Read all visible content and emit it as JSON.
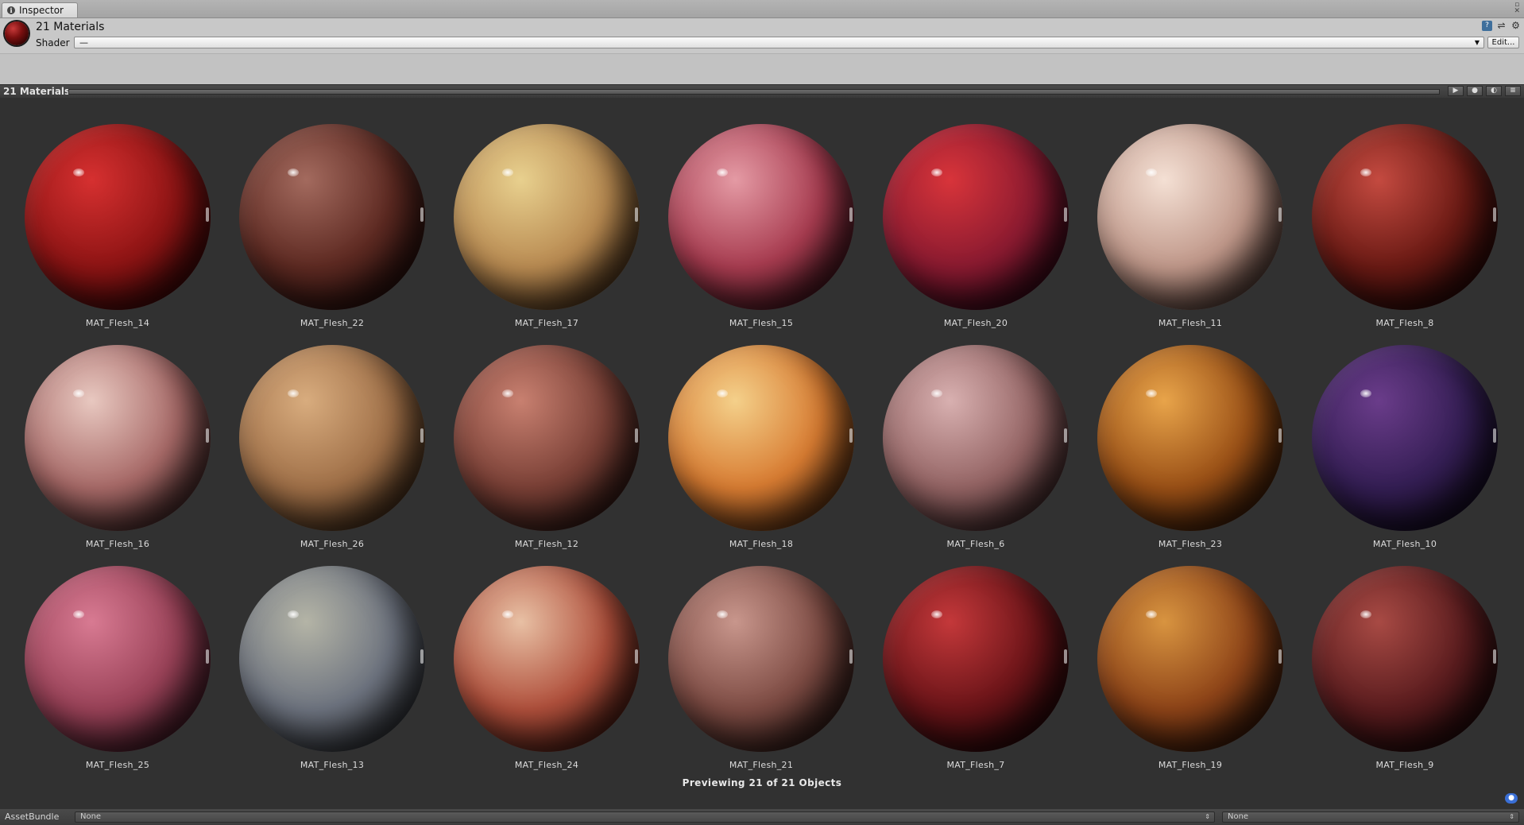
{
  "tab": {
    "label": "Inspector",
    "icon": "info-icon"
  },
  "header": {
    "title": "21 Materials",
    "shader_label": "Shader",
    "shader_value": "—",
    "edit_label": "Edit...",
    "icons": [
      "help-book-icon",
      "preset-icon",
      "gear-icon"
    ]
  },
  "preview": {
    "title": "21 Materials",
    "controls": [
      "play-icon",
      "sphere-preview-icon",
      "light-toggle-icon",
      "menu-icon"
    ],
    "status": "Previewing 21 of 21 Objects"
  },
  "materials": [
    {
      "name": "MAT_Flesh_14",
      "colors": [
        "#d63030",
        "#8e1414",
        "#3a0505"
      ]
    },
    {
      "name": "MAT_Flesh_22",
      "colors": [
        "#a36a5e",
        "#5e2a22",
        "#230a08"
      ]
    },
    {
      "name": "MAT_Flesh_17",
      "colors": [
        "#e8d08e",
        "#b98b52",
        "#4a2a12"
      ]
    },
    {
      "name": "MAT_Flesh_15",
      "colors": [
        "#e49aa4",
        "#a83c50",
        "#3a0c14"
      ]
    },
    {
      "name": "MAT_Flesh_20",
      "colors": [
        "#d8343a",
        "#8a1a30",
        "#2a0518"
      ]
    },
    {
      "name": "MAT_Flesh_11",
      "colors": [
        "#f4e0d4",
        "#c0988a",
        "#4a3028"
      ]
    },
    {
      "name": "MAT_Flesh_8",
      "colors": [
        "#c44a40",
        "#6a1a14",
        "#1e0404"
      ]
    },
    {
      "name": "MAT_Flesh_16",
      "colors": [
        "#e8c8c0",
        "#a86a68",
        "#3a1e1e"
      ]
    },
    {
      "name": "MAT_Flesh_26",
      "colors": [
        "#d8ac7e",
        "#a07048",
        "#3e2612"
      ]
    },
    {
      "name": "MAT_Flesh_12",
      "colors": [
        "#c88070",
        "#7a4036",
        "#2a1410"
      ]
    },
    {
      "name": "MAT_Flesh_18",
      "colors": [
        "#f4d08a",
        "#d87c32",
        "#5a2a0c"
      ]
    },
    {
      "name": "MAT_Flesh_6",
      "colors": [
        "#d8b0b0",
        "#946464",
        "#3a2224"
      ]
    },
    {
      "name": "MAT_Flesh_23",
      "colors": [
        "#e8a44a",
        "#9a5016",
        "#2e1004"
      ]
    },
    {
      "name": "MAT_Flesh_10",
      "colors": [
        "#6a3c8a",
        "#341e54",
        "#0e0818"
      ]
    },
    {
      "name": "MAT_Flesh_25",
      "colors": [
        "#d87a92",
        "#9a4258",
        "#3a1420"
      ]
    },
    {
      "name": "MAT_Flesh_13",
      "colors": [
        "#b4b4a6",
        "#6e7480",
        "#2a2c30"
      ]
    },
    {
      "name": "MAT_Flesh_24",
      "colors": [
        "#e8c0a4",
        "#b0503c",
        "#4a140c"
      ]
    },
    {
      "name": "MAT_Flesh_21",
      "colors": [
        "#c8968c",
        "#7e4c44",
        "#2a1410"
      ]
    },
    {
      "name": "MAT_Flesh_7",
      "colors": [
        "#c4383a",
        "#6a1418",
        "#1a0406"
      ]
    },
    {
      "name": "MAT_Flesh_19",
      "colors": [
        "#d89440",
        "#8e4418",
        "#2e1006"
      ]
    },
    {
      "name": "MAT_Flesh_9",
      "colors": [
        "#a84a44",
        "#5a1c1e",
        "#1a0506"
      ]
    }
  ],
  "asset_bundle": {
    "label": "AssetBundle",
    "name_value": "None",
    "variant_value": "None"
  }
}
